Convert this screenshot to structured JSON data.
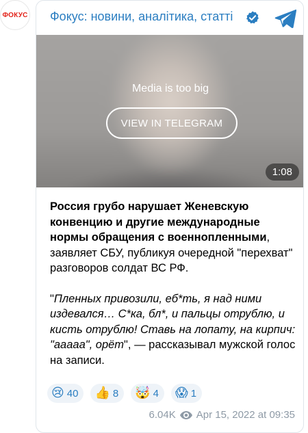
{
  "avatar": {
    "label": "ФОКУС"
  },
  "header": {
    "channel_title": "Фокус: новини, аналітика, статті"
  },
  "media": {
    "notice": "Media is too big",
    "button_label": "VIEW IN TELEGRAM",
    "duration": "1:08"
  },
  "post": {
    "headline_bold": "Россия грубо нарушает Женевскую конвенцию и другие международные нормы обращения с военнопленными",
    "headline_rest": ", заявляет СБУ, публикуя очередной \"перехват\" разговоров солдат ВС РФ.",
    "quote_open": "\"",
    "quote_italic": "Пленных привозили, еб*ть, я над ними издевался… С*ка, бл*, и пальцы отрублю, и кисть отрублю! Ставь на лопату, на кирпич: \"ааааа\", орёт",
    "quote_rest": "\", — рассказывал мужской голос на записи."
  },
  "reactions": [
    {
      "emoji": "😢",
      "icon": "crying-face-icon",
      "count": "40"
    },
    {
      "emoji": "👍",
      "icon": "thumbs-up-icon",
      "count": "8"
    },
    {
      "emoji": "🤯",
      "icon": "exploding-head-icon",
      "count": "4"
    },
    {
      "emoji": "😱",
      "icon": "screaming-face-icon",
      "count": "1"
    }
  ],
  "footer": {
    "views": "6.04K",
    "date": "Apr 15, 2022 at 09:35"
  },
  "colors": {
    "accent": "#2b7ec1",
    "avatar_text": "#e2231a",
    "meta": "#8e9aa6"
  }
}
